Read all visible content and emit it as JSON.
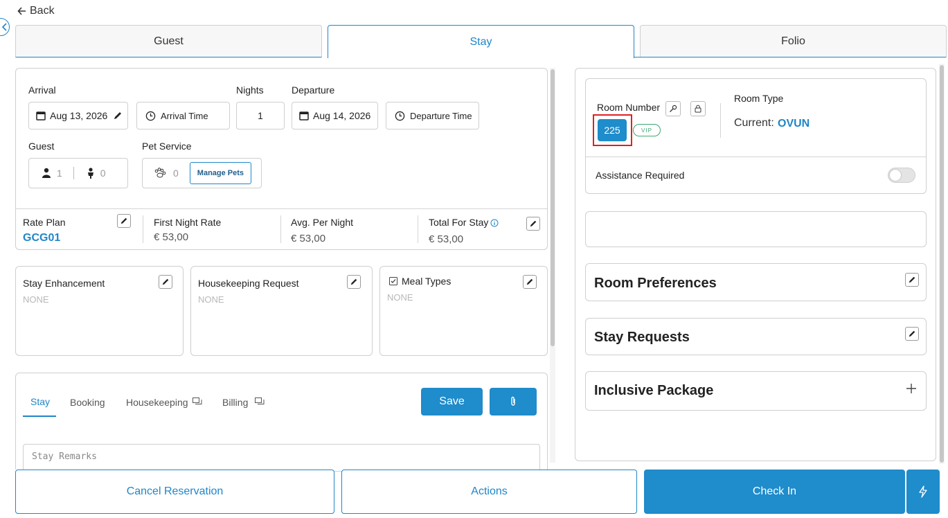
{
  "nav": {
    "back_label": "Back"
  },
  "tabs": [
    {
      "label": "Guest"
    },
    {
      "label": "Stay"
    },
    {
      "label": "Folio"
    }
  ],
  "stay": {
    "arrival_label": "Arrival",
    "arrival_date": "Aug 13, 2026",
    "arrival_time_placeholder": "Arrival Time",
    "nights_label": "Nights",
    "nights_value": "1",
    "departure_label": "Departure",
    "departure_date": "Aug 14, 2026",
    "departure_time_placeholder": "Departure Time",
    "guest_label": "Guest",
    "adults": "1",
    "children": "0",
    "pet_label": "Pet Service",
    "pets": "0",
    "manage_pets": "Manage Pets"
  },
  "rates": {
    "rate_plan_label": "Rate Plan",
    "rate_plan_value": "GCG01",
    "first_night_label": "First Night Rate",
    "first_night_value": "€ 53,00",
    "avg_label": "Avg. Per Night",
    "avg_value": "€ 53,00",
    "total_label": "Total For Stay",
    "total_value": "€ 53,00"
  },
  "extras": [
    {
      "title": "Stay Enhancement",
      "value": "NONE"
    },
    {
      "title": "Housekeeping Request",
      "value": "NONE"
    },
    {
      "title": "Meal Types",
      "value": "NONE"
    }
  ],
  "remarks": {
    "tabs": [
      "Stay",
      "Booking",
      "Housekeeping",
      "Billing"
    ],
    "save_label": "Save",
    "placeholder": "Stay Remarks"
  },
  "room": {
    "number_label": "Room Number",
    "number_value": "225",
    "vip_badge": "VIP",
    "type_label": "Room Type",
    "current_label": "Current:",
    "current_value": "OVUN",
    "assistance_label": "Assistance Required",
    "assistance_on": false
  },
  "sections": {
    "room_preferences": "Room Preferences",
    "stay_requests": "Stay Requests",
    "inclusive_package": "Inclusive Package"
  },
  "footer": {
    "cancel_label": "Cancel Reservation",
    "actions_label": "Actions",
    "checkin_label": "Check In"
  },
  "colors": {
    "accent": "#1f8ccb",
    "highlight": "#e02020",
    "vip_green": "#3aa874"
  }
}
